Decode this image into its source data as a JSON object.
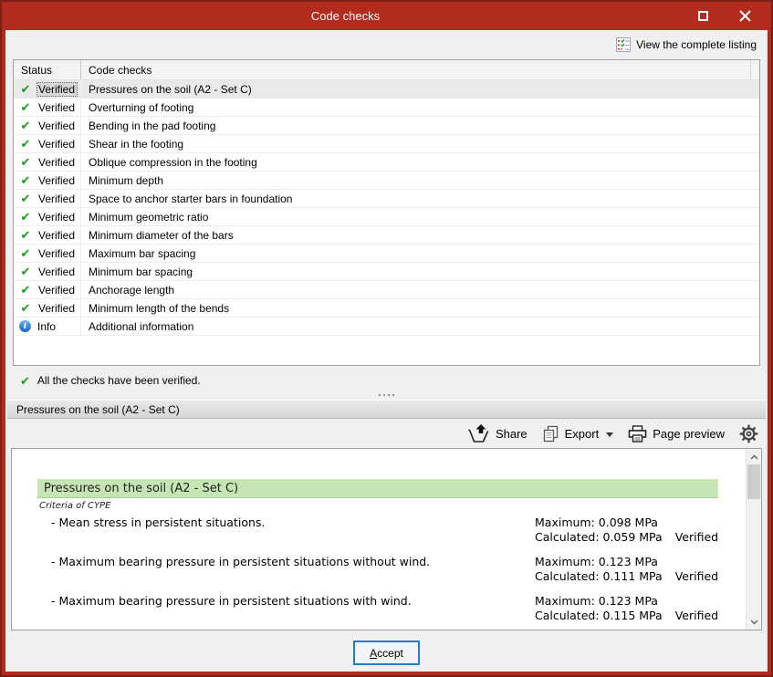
{
  "window": {
    "title": "Code checks"
  },
  "header": {
    "view_listing_label": "View the complete listing"
  },
  "table": {
    "columns": [
      "Status",
      "Code checks"
    ],
    "rows": [
      {
        "icon": "check",
        "status": "Verified",
        "check": "Pressures on the soil (A2 - Set C)",
        "selected": true
      },
      {
        "icon": "check",
        "status": "Verified",
        "check": "Overturning of footing",
        "selected": false
      },
      {
        "icon": "check",
        "status": "Verified",
        "check": "Bending in the pad footing",
        "selected": false
      },
      {
        "icon": "check",
        "status": "Verified",
        "check": "Shear in the footing",
        "selected": false
      },
      {
        "icon": "check",
        "status": "Verified",
        "check": "Oblique compression in the footing",
        "selected": false
      },
      {
        "icon": "check",
        "status": "Verified",
        "check": "Minimum depth",
        "selected": false
      },
      {
        "icon": "check",
        "status": "Verified",
        "check": "Space to anchor starter bars in foundation",
        "selected": false
      },
      {
        "icon": "check",
        "status": "Verified",
        "check": "Minimum geometric ratio",
        "selected": false
      },
      {
        "icon": "check",
        "status": "Verified",
        "check": "Minimum diameter of the bars",
        "selected": false
      },
      {
        "icon": "check",
        "status": "Verified",
        "check": "Maximum bar spacing",
        "selected": false
      },
      {
        "icon": "check",
        "status": "Verified",
        "check": "Minimum bar spacing",
        "selected": false
      },
      {
        "icon": "check",
        "status": "Verified",
        "check": "Anchorage length",
        "selected": false
      },
      {
        "icon": "check",
        "status": "Verified",
        "check": "Minimum length of the bends",
        "selected": false
      },
      {
        "icon": "info",
        "status": "Info",
        "check": "Additional information",
        "selected": false
      }
    ]
  },
  "summary": {
    "message": "All the checks have been verified."
  },
  "section": {
    "title": "Pressures on the soil (A2 - Set C)"
  },
  "toolbar": {
    "share_label": "Share",
    "export_label": "Export",
    "page_preview_label": "Page preview"
  },
  "report": {
    "title": "Pressures on the soil (A2 - Set C)",
    "criteria": "Criteria of CYPE",
    "items": [
      {
        "label": "- Mean stress in persistent situations.",
        "maximum": "Maximum: 0.098 MPa",
        "calculated": "Calculated: 0.059 MPa",
        "status": "Verified"
      },
      {
        "label": "- Maximum bearing pressure in persistent situations without wind.",
        "maximum": "Maximum: 0.123 MPa",
        "calculated": "Calculated: 0.111 MPa",
        "status": "Verified"
      },
      {
        "label": "- Maximum bearing pressure in persistent situations with wind.",
        "maximum": "Maximum: 0.123 MPa",
        "calculated": "Calculated: 0.115 MPa",
        "status": "Verified"
      }
    ]
  },
  "footer": {
    "accept_label": "Accept"
  },
  "colors": {
    "titlebar_red": "#b22b1e",
    "frame_outer": "#7c1f14",
    "verified_green": "#1b9b1b",
    "info_blue": "#2579d8",
    "report_header_green": "#c5e5b4",
    "accent_blue": "#1a7fd4"
  }
}
